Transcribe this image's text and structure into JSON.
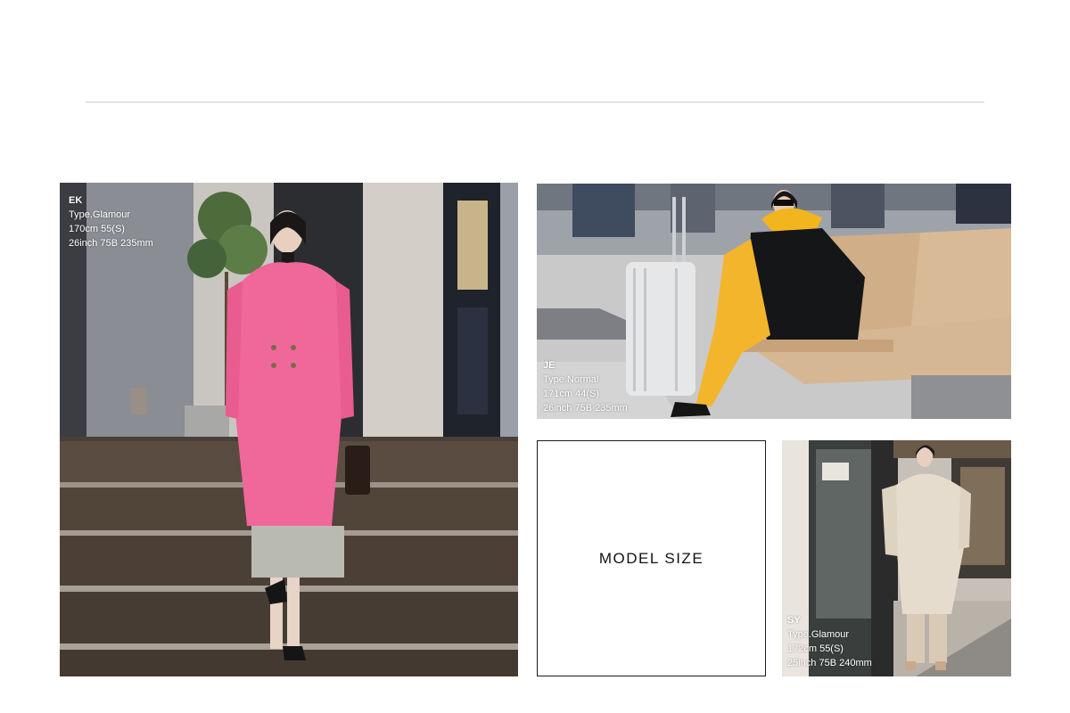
{
  "models": [
    {
      "code": "EK",
      "type": "Type.Glamour",
      "height_size": "170cm 55(S)",
      "measurements": "26inch 75B 235mm"
    },
    {
      "code": "JE",
      "type": "Type.Normal",
      "height_size": "171cm 44(S)",
      "measurements": "26inch 75B 235mm"
    },
    {
      "code": "SY",
      "type": "Type.Glamour",
      "height_size": "172cm 55(S)",
      "measurements": "25inch 75B 240mm"
    }
  ],
  "model_size_label": "MODEL SIZE",
  "colors": {
    "divider": "#cfcfcf",
    "caption_text": "#ffffff",
    "coat_pink": "#f0679a",
    "fur_yellow": "#f2b51e",
    "trousers_yellow": "#f3b52c",
    "trench_cream": "#e6dccd"
  }
}
